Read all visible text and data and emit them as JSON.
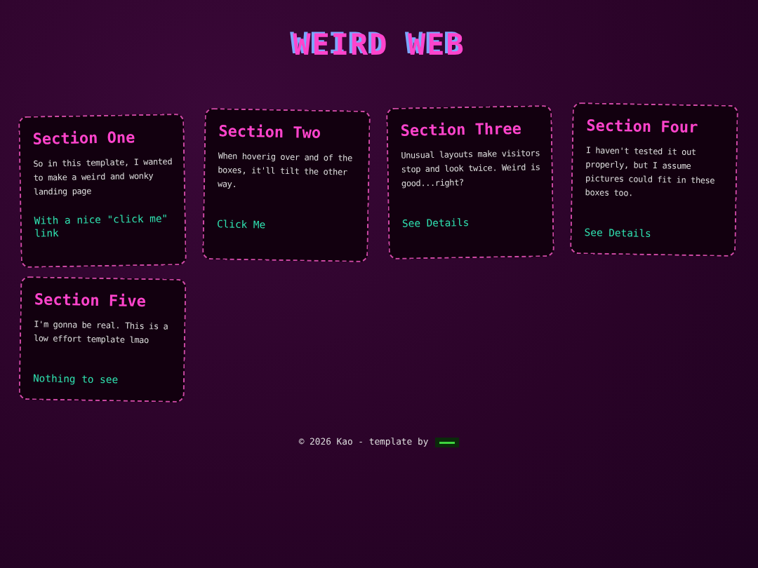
{
  "header": {
    "title": "WEIRD WEB"
  },
  "sections": [
    {
      "title": "Section One",
      "text": "So in this template, I wanted to make a weird and wonky landing page",
      "link": "With a nice \"click me\" link"
    },
    {
      "title": "Section Two",
      "text": "When hoverig over and of the boxes, it'll tilt the other way.",
      "link": "Click Me"
    },
    {
      "title": "Section Three",
      "text": "Unusual layouts make visitors stop and look twice. Weird is good...right?",
      "link": "See Details"
    },
    {
      "title": "Section Four",
      "text": "I haven't tested it out properly, but I assume pictures could fit in these boxes too.",
      "link": "See Details"
    },
    {
      "title": "Section Five",
      "text": "I'm gonna be real. This is a low effort template lmao",
      "link": "Nothing to see"
    }
  ],
  "footer": {
    "text": "© 2026 Kao - template by"
  }
}
